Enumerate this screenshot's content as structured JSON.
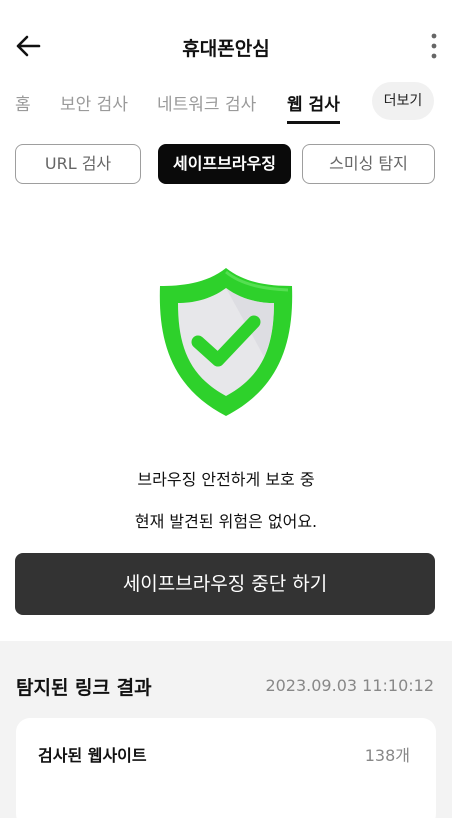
{
  "header": {
    "title": "휴대폰안심",
    "back_icon": "back-arrow-icon",
    "menu_icon": "more-vert-icon"
  },
  "tabs": [
    {
      "label": "홈"
    },
    {
      "label": "보안 검사"
    },
    {
      "label": "네트워크 검사"
    },
    {
      "label": "웹 검사",
      "active": true
    }
  ],
  "more_label": "더보기",
  "segments": [
    {
      "label": "URL 검사"
    },
    {
      "label": "세이프브라우징",
      "selected": true
    },
    {
      "label": "스미싱 탐지"
    }
  ],
  "status": {
    "icon": "shield-check-icon",
    "line1": "브라우징 안전하게 보호 중",
    "line2": "현재 발견된 위험은 없어요.",
    "colors": {
      "shield": "#2ed12b",
      "check": "#2ed12b",
      "inner": "#e7e7ea"
    }
  },
  "stop_button": {
    "label": "세이프브라우징 중단 하기"
  },
  "results": {
    "title": "탐지된 링크 결과",
    "timestamp": "2023.09.03 11:10:12",
    "card": {
      "label": "검사된 웹사이트",
      "count": "138개"
    }
  }
}
